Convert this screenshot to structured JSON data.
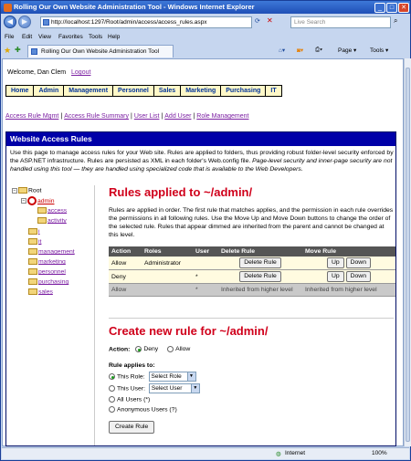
{
  "window": {
    "title": "Rolling Our Own Website Administration Tool - Windows Internet Explorer",
    "min": "_",
    "max": "□",
    "close": "✕"
  },
  "browser": {
    "address": "http://localhost:1297/Root/admin/access/access_rules.aspx",
    "search_placeholder": "Live Search",
    "menu": [
      "File",
      "Edit",
      "View",
      "Favorites",
      "Tools",
      "Help"
    ],
    "tab_title": "Rolling Our Own Website Administration Tool",
    "page_label": "Page ▾",
    "tools_label": "Tools ▾",
    "status_zone": "Internet",
    "zoom": "100%"
  },
  "header": {
    "welcome": "Welcome, Dan Clem",
    "logout": "Logout"
  },
  "nav": [
    "Home",
    "Admin",
    "Management",
    "Personnel",
    "Sales",
    "Marketing",
    "Purchasing",
    "IT"
  ],
  "sublinks": [
    "Access Rule Mgmt",
    "Access Rule Summary",
    "User List",
    "Add User",
    "Role Management"
  ],
  "panel": {
    "title": "Website Access Rules",
    "intro": "Use this page to manage access rules for your Web site. Rules are applied to folders, thus providing robust folder-level security enforced by the ASP.NET infrastructure. Rules are persisted as XML in each folder's Web.config file. ",
    "intro_italic": "Page-level security and inner-page security are not handled using this tool — they are handled using specialized code that is available to the Web Developers."
  },
  "tree": {
    "root": "Root",
    "selected": "admin",
    "admin_children": [
      "access",
      "activity"
    ],
    "root_children": [
      "i",
      "it",
      "management",
      "marketing",
      "personnel",
      "purchasing",
      "sales"
    ]
  },
  "rules": {
    "heading": "Rules applied to ~/admin/",
    "description": "Rules are applied in order. The first rule that matches applies, and the permission in each rule overrides the permissions in all following rules. Use the Move Up and Move Down buttons to change the order of the selected rule. Rules that appear dimmed are inherited from the parent and cannot be changed at this level.",
    "columns": [
      "Action",
      "Roles",
      "User",
      "Delete Rule",
      "Move Rule"
    ],
    "rows": [
      {
        "action": "Allow",
        "roles": "Administrator",
        "user": "",
        "delete": "Delete Rule",
        "up": "Up",
        "down": "Down"
      },
      {
        "action": "Deny",
        "roles": "",
        "user": "*",
        "delete": "Delete Rule",
        "up": "Up",
        "down": "Down"
      },
      {
        "action": "Allow",
        "roles": "",
        "user": "*",
        "delete": "Inherited from higher level",
        "move": "Inherited from higher level"
      }
    ]
  },
  "create": {
    "heading": "Create new rule for ~/admin/",
    "action_label": "Action:",
    "deny": "Deny",
    "allow": "Allow",
    "applies_label": "Rule applies to:",
    "this_role": "This Role:",
    "role_select": "Select Role",
    "this_user": "This User:",
    "user_select": "Select User",
    "all_users": "All Users (*)",
    "anonymous": "Anonymous Users (?)",
    "button": "Create Rule"
  }
}
